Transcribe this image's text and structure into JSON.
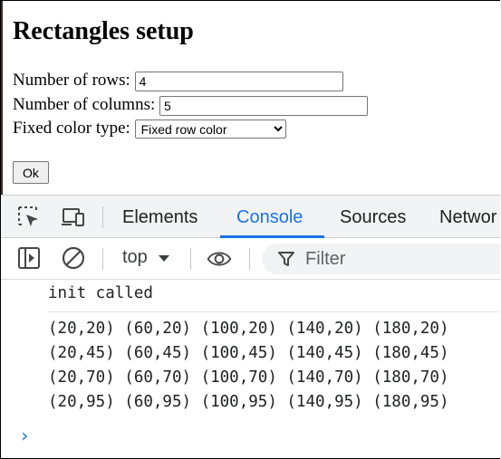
{
  "page": {
    "title": "Rectangles setup",
    "rows_label": "Number of rows:",
    "rows_value": "4",
    "cols_label": "Number of columns:",
    "cols_value": "5",
    "color_label": "Fixed color type:",
    "color_selected": "Fixed row color",
    "ok_label": "Ok"
  },
  "devtools": {
    "tabs": [
      "Elements",
      "Console",
      "Sources",
      "Networ"
    ],
    "active_tab": "Console",
    "context": "top",
    "filter_placeholder": "Filter",
    "console_lines": [
      "init called",
      "(20,20) (60,20) (100,20) (140,20) (180,20)",
      "(20,45) (60,45) (100,45) (140,45) (180,45)",
      "(20,70) (60,70) (100,70) (140,70) (180,70)",
      "(20,95) (60,95) (100,95) (140,95) (180,95)"
    ],
    "prompt": "›"
  },
  "colors": {
    "accent": "#1a73e8",
    "toolbar_bg": "#f1f3f4"
  },
  "icons": [
    "inspect-element-icon",
    "device-toolbar-icon",
    "sidebar-toggle-icon",
    "clear-console-icon",
    "dropdown-caret-icon",
    "eye-icon",
    "filter-icon",
    "console-prompt-icon"
  ]
}
